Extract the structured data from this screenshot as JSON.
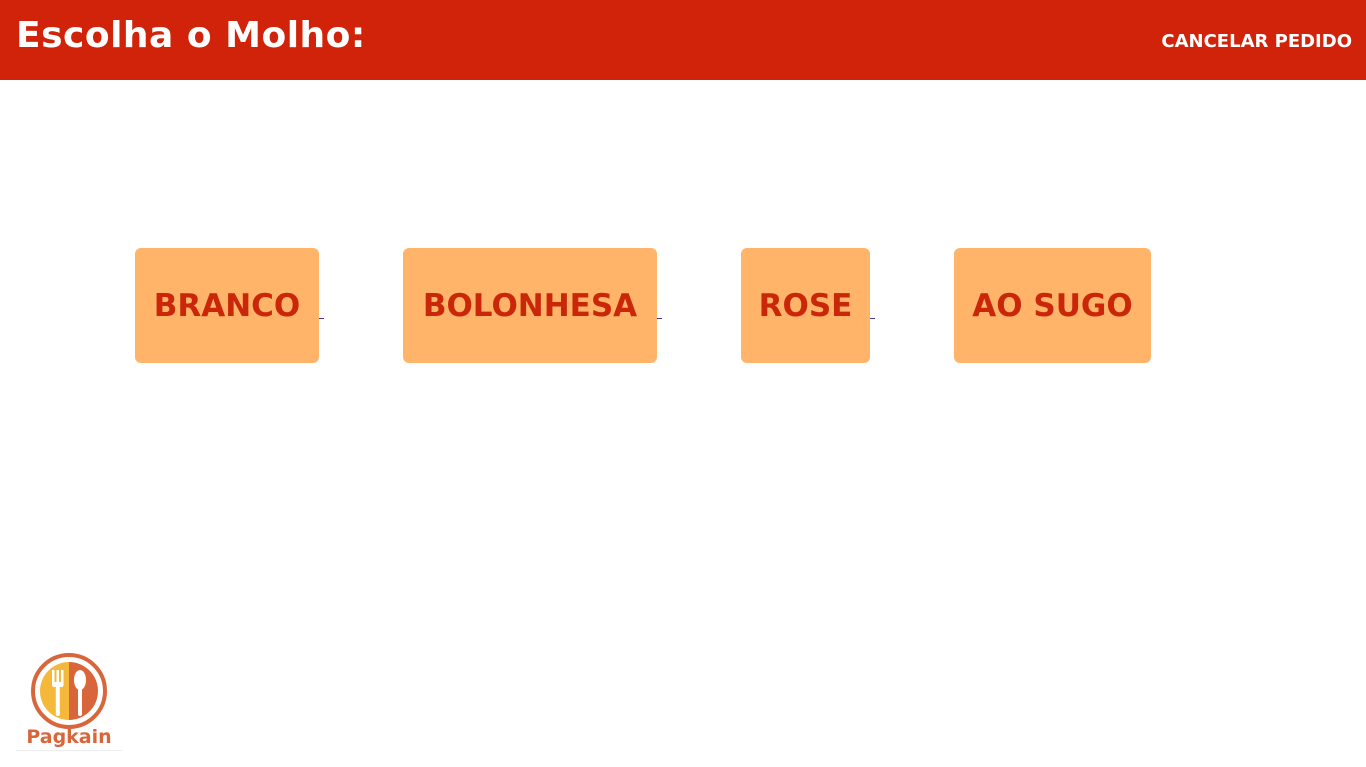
{
  "header": {
    "title": "Escolha o Molho:",
    "cancel_label": "CANCELAR PEDIDO"
  },
  "options": [
    {
      "label": "BRANCO"
    },
    {
      "label": "BOLONHESA"
    },
    {
      "label": "ROSE"
    },
    {
      "label": "AO SUGO"
    }
  ],
  "logo": {
    "text": "Pagkain",
    "icon": "fork-spoon-plate-icon"
  },
  "colors": {
    "header_bg": "#d12309",
    "option_bg": "#ffb469",
    "option_text": "#c9260a",
    "logo_orange": "#d9653a",
    "logo_yellow": "#f5b83a"
  }
}
